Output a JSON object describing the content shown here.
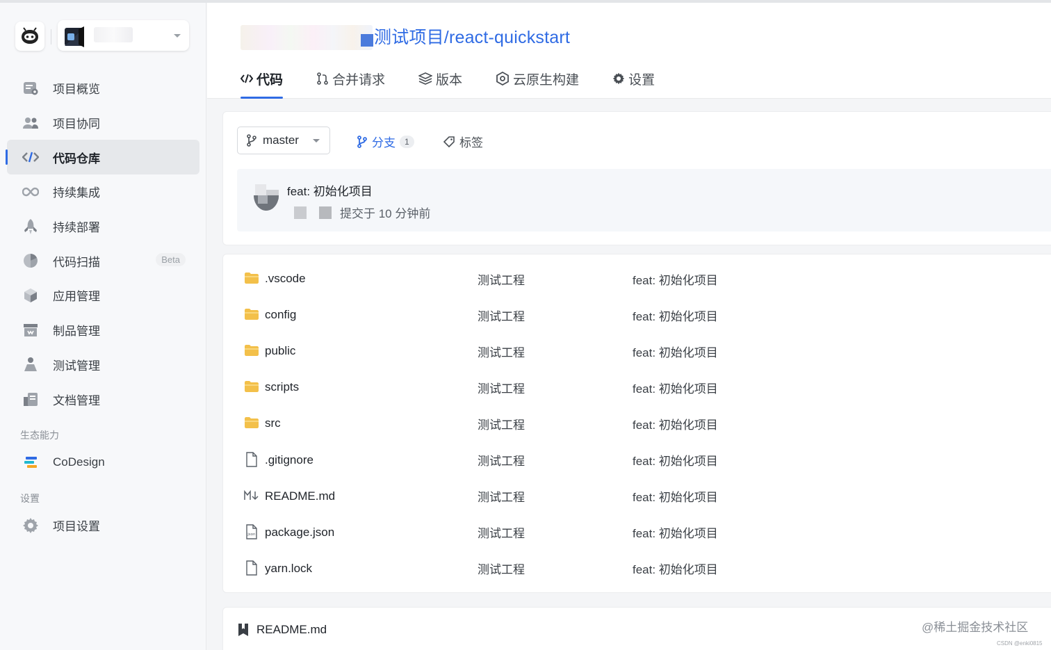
{
  "sidebar": {
    "nav": [
      {
        "label": "项目概览",
        "icon": "overview-icon"
      },
      {
        "label": "项目协同",
        "icon": "users-icon"
      },
      {
        "label": "代码仓库",
        "icon": "code-icon",
        "active": true
      },
      {
        "label": "持续集成",
        "icon": "infinity-icon"
      },
      {
        "label": "持续部署",
        "icon": "rocket-icon"
      },
      {
        "label": "代码扫描",
        "icon": "pie-icon",
        "badge": "Beta"
      },
      {
        "label": "应用管理",
        "icon": "cube-icon"
      },
      {
        "label": "制品管理",
        "icon": "archive-icon"
      },
      {
        "label": "测试管理",
        "icon": "flask-icon"
      },
      {
        "label": "文档管理",
        "icon": "docs-icon"
      }
    ],
    "eco_label": "生态能力",
    "eco_item": "CoDesign",
    "settings_label": "设置",
    "settings_item": "项目设置"
  },
  "header": {
    "path": "测试项目/react-quickstart",
    "tabs": [
      {
        "label": "代码",
        "icon": "code-icon",
        "active": true
      },
      {
        "label": "合并请求",
        "icon": "merge-icon"
      },
      {
        "label": "版本",
        "icon": "layers-icon"
      },
      {
        "label": "云原生构建",
        "icon": "build-icon"
      },
      {
        "label": "设置",
        "icon": "gear-icon"
      }
    ]
  },
  "repo": {
    "branch": "master",
    "branches_label": "分支",
    "branches_count": "1",
    "tags_label": "标签",
    "commit_message": "feat: 初始化项目",
    "commit_time": "提交于 10 分钟前"
  },
  "files": [
    {
      "name": ".vscode",
      "type": "folder",
      "commit": "测试工程",
      "message": "feat: 初始化项目"
    },
    {
      "name": "config",
      "type": "folder",
      "commit": "测试工程",
      "message": "feat: 初始化项目"
    },
    {
      "name": "public",
      "type": "folder",
      "commit": "测试工程",
      "message": "feat: 初始化项目"
    },
    {
      "name": "scripts",
      "type": "folder",
      "commit": "测试工程",
      "message": "feat: 初始化项目"
    },
    {
      "name": "src",
      "type": "folder",
      "commit": "测试工程",
      "message": "feat: 初始化项目"
    },
    {
      "name": ".gitignore",
      "type": "file",
      "commit": "测试工程",
      "message": "feat: 初始化项目"
    },
    {
      "name": "README.md",
      "type": "markdown",
      "commit": "测试工程",
      "message": "feat: 初始化项目"
    },
    {
      "name": "package.json",
      "type": "json",
      "commit": "测试工程",
      "message": "feat: 初始化项目"
    },
    {
      "name": "yarn.lock",
      "type": "file",
      "commit": "测试工程",
      "message": "feat: 初始化项目"
    }
  ],
  "readme": {
    "title": "README.md"
  },
  "watermark": "@稀土掘金技术社区",
  "watermark_small": "CSDN @enki0815",
  "colors": {
    "accent": "#2f6be4",
    "folder": "#f3c04a",
    "sidebar_bg": "#f7f8fa"
  }
}
